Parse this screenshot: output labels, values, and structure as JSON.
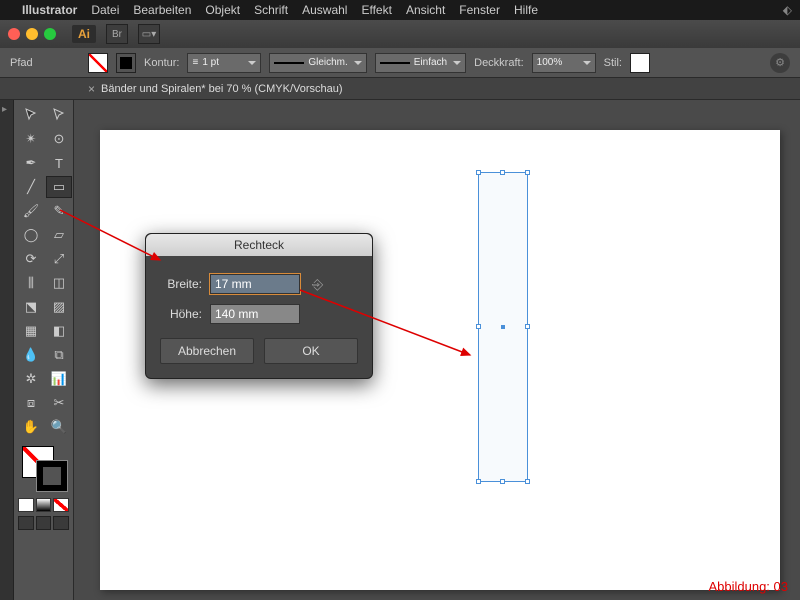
{
  "menubar": {
    "items": [
      "Illustrator",
      "Datei",
      "Bearbeiten",
      "Objekt",
      "Schrift",
      "Auswahl",
      "Effekt",
      "Ansicht",
      "Fenster",
      "Hilfe"
    ]
  },
  "controlbar": {
    "selection": "Pfad",
    "stroke_label": "Kontur:",
    "stroke_weight": "1 pt",
    "cap_label": "Gleichm.",
    "dash_label": "Einfach",
    "opacity_label": "Deckkraft:",
    "opacity_value": "100%",
    "style_label": "Stil:"
  },
  "tab": {
    "title": "Bänder und Spiralen* bei 70 % (CMYK/Vorschau)"
  },
  "dialog": {
    "title": "Rechteck",
    "width_label": "Breite:",
    "width_value": "17 mm",
    "height_label": "Höhe:",
    "height_value": "140 mm",
    "cancel": "Abbrechen",
    "ok": "OK"
  },
  "caption": "Abbildung: 03"
}
